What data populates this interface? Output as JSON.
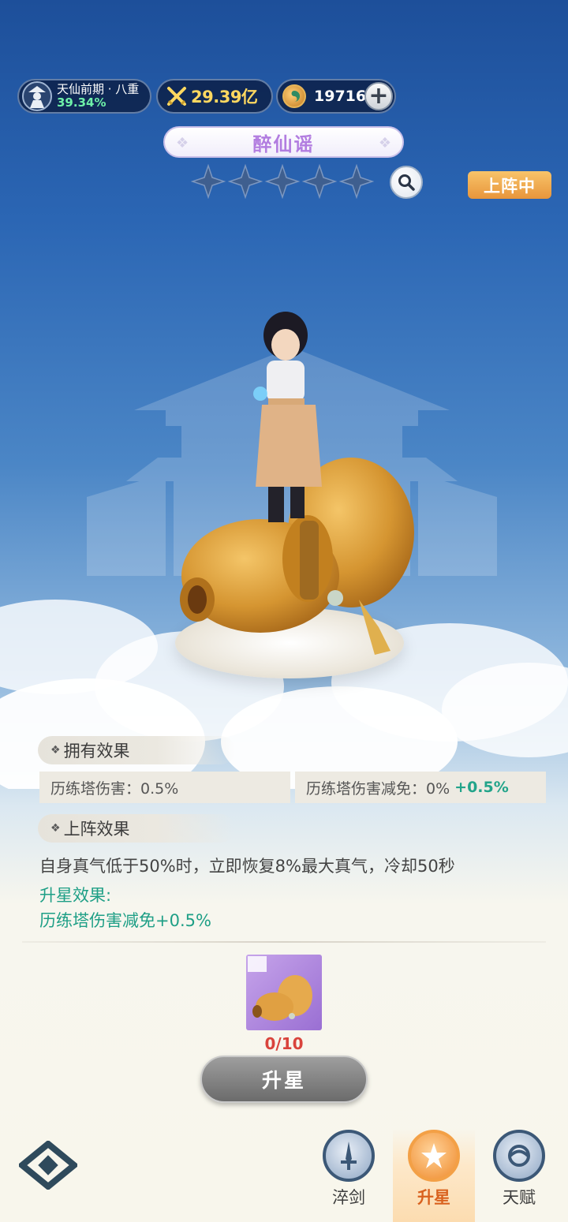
{
  "header": {
    "rank_name": "天仙前期 · 八重",
    "rank_progress": "39.34%",
    "combat_power": "29.39亿",
    "currency_amount": "19716",
    "add_label": "+"
  },
  "item": {
    "name": "醉仙谣",
    "stars_total": 5,
    "stars_filled": 0,
    "status_badge": "上阵中"
  },
  "owned_effect": {
    "title": "拥有效果",
    "stat1_label": "历练塔伤害：0.5%",
    "stat2_label": "历练塔伤害减免：0%",
    "stat2_bonus": "+0.5%"
  },
  "deploy_effect": {
    "title": "上阵效果",
    "description": "自身真气低于50%时，立即恢复8%最大真气，冷却50秒",
    "upgrade_title": "升星效果:",
    "upgrade_desc": "历练塔伤害减免+0.5%"
  },
  "upgrade": {
    "fragment_count": "0/10",
    "button_label": "升星"
  },
  "nav": {
    "items": [
      {
        "label": "淬剑"
      },
      {
        "label": "升星"
      },
      {
        "label": "天赋"
      }
    ],
    "active_index": 1
  },
  "colors": {
    "accent_green": "#1e9f86",
    "badge_orange": "#e8953b",
    "item_name_purple": "#b27de0",
    "count_red": "#d9433c"
  }
}
